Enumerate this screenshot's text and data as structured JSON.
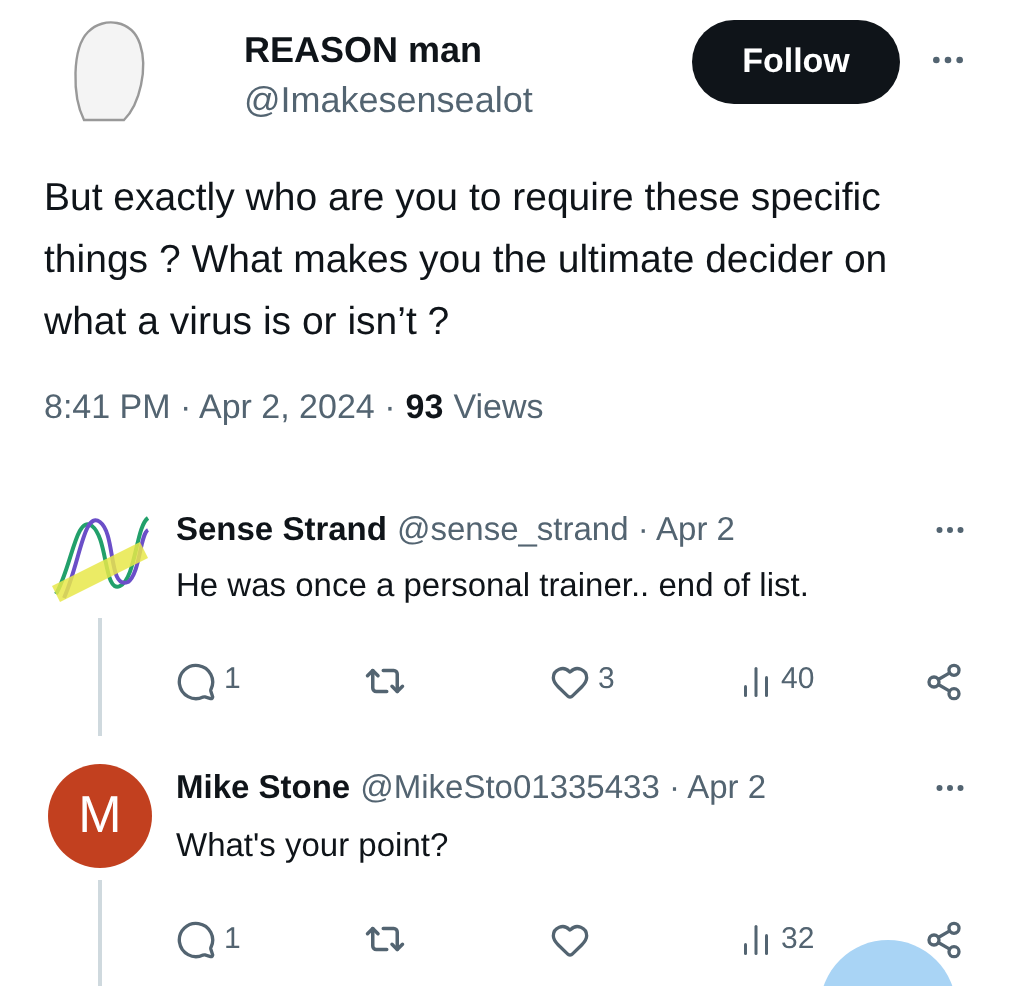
{
  "tweet": {
    "name": "REASON man",
    "handle": "@Imakesensealot",
    "follow_label": "Follow",
    "text": "But exactly who are you to require these specific things ? What makes you the ultimate decider on what a virus is or isn’t ?",
    "timestamp": "8:41 PM · Apr 2, 2024 ·",
    "views_count": "93",
    "views_label": "Views"
  },
  "replies": [
    {
      "name": "Sense Strand",
      "meta": "@sense_strand · Apr 2",
      "text": "He was once a personal trainer.. end of list.",
      "avatar": {
        "kind": "logo"
      },
      "stats": {
        "replies": "1",
        "likes": "3",
        "views": "40"
      }
    },
    {
      "name": "Mike Stone",
      "meta": "@MikeSto01335433 · Apr 2",
      "text": "What's your point?",
      "avatar": {
        "kind": "letter",
        "letter": "M",
        "color": "#c2401f"
      },
      "stats": {
        "replies": "1",
        "views": "32"
      }
    }
  ]
}
